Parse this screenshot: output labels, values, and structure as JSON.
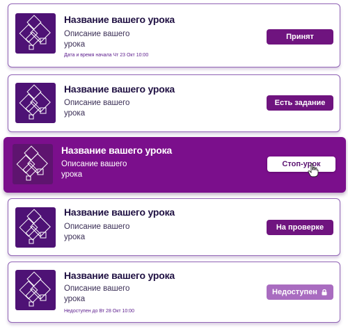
{
  "lessons": [
    {
      "title": "Название вашего урока",
      "description": "Описание вашего урока",
      "meta": "Дата и время начала Чт 23 Окт 10:00",
      "button": "Принят"
    },
    {
      "title": "Название вашего урока",
      "description": "Описание вашего урока",
      "button": "Есть задание"
    },
    {
      "title": "Название вашего урока",
      "description": "Описание вашего урока",
      "button": "Стоп-урок"
    },
    {
      "title": "Название вашего урока",
      "description": "Описание вашего урока",
      "button": "На проверке"
    },
    {
      "title": "Название вашего урока",
      "description": "Описание вашего урока",
      "meta": "Недоступен до Вт 28 Окт 10:00",
      "button": "Недоступен"
    }
  ],
  "colors": {
    "accent": "#6f147f",
    "active_card": "#7b0f8c",
    "thumb": "#4e1275",
    "disabled_button": "#a96cc0"
  },
  "icons": {
    "thumbnail": "diamond-pattern-icon",
    "lock": "lock-icon",
    "cursor": "hand-pointer-icon"
  }
}
